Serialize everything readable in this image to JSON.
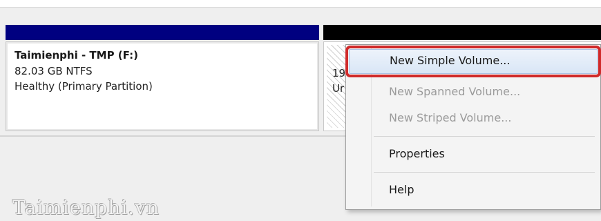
{
  "partition": {
    "name": "Taimienphi - TMP (F:)",
    "size": "82.03 GB NTFS",
    "status": "Healthy (Primary Partition)"
  },
  "unallocated": {
    "capacity_partial": "19",
    "type_partial": "Ur"
  },
  "context_menu": {
    "items": [
      {
        "label": "New Simple Volume...",
        "enabled": true,
        "highlighted": true
      },
      {
        "label": "New Spanned Volume...",
        "enabled": false
      },
      {
        "label": "New Striped Volume...",
        "enabled": false
      },
      {
        "label": "Properties",
        "enabled": true
      },
      {
        "label": "Help",
        "enabled": true
      }
    ]
  },
  "watermark": "Taimienphi.vn",
  "colors": {
    "primary_partition_bar": "#000080",
    "unallocated_bar": "#000000",
    "highlight_outline": "#d02a2a"
  }
}
